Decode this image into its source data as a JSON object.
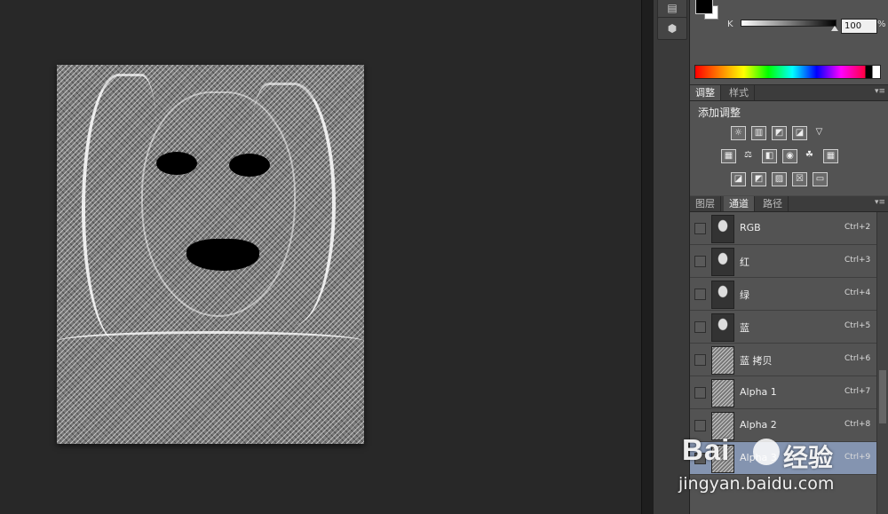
{
  "color_panel": {
    "channel_label": "K",
    "k_value": "100",
    "percent_symbol": "%",
    "foreground_color": "#000000",
    "background_color": "#ffffff"
  },
  "adjustments_panel": {
    "tabs": [
      {
        "label": "调整",
        "active": true
      },
      {
        "label": "样式",
        "active": false
      }
    ],
    "title": "添加调整",
    "rows": [
      [
        "brightness-contrast-icon",
        "levels-icon",
        "curves-icon",
        "exposure-icon",
        "vibrance-icon"
      ],
      [
        "hue-saturation-icon",
        "color-balance-icon",
        "black-white-icon",
        "photo-filter-icon",
        "channel-mixer-icon",
        "color-lookup-icon"
      ],
      [
        "invert-icon",
        "posterize-icon",
        "threshold-icon",
        "selective-color-icon",
        "gradient-map-icon"
      ]
    ]
  },
  "channels_panel": {
    "tabs": [
      {
        "label": "图层",
        "active": false
      },
      {
        "label": "通道",
        "active": true
      },
      {
        "label": "路径",
        "active": false
      }
    ],
    "rows": [
      {
        "name": "RGB",
        "shortcut": "Ctrl+2",
        "thumb": "photo",
        "selected": false
      },
      {
        "name": "红",
        "shortcut": "Ctrl+3",
        "thumb": "photo",
        "selected": false
      },
      {
        "name": "绿",
        "shortcut": "Ctrl+4",
        "thumb": "photo",
        "selected": false
      },
      {
        "name": "蓝",
        "shortcut": "Ctrl+5",
        "thumb": "photo",
        "selected": false
      },
      {
        "name": "蓝 拷贝",
        "shortcut": "Ctrl+6",
        "thumb": "alpha",
        "selected": false
      },
      {
        "name": "Alpha 1",
        "shortcut": "Ctrl+7",
        "thumb": "alpha",
        "selected": false
      },
      {
        "name": "Alpha 2",
        "shortcut": "Ctrl+8",
        "thumb": "alpha",
        "selected": false
      },
      {
        "name": "Alpha 3",
        "shortcut": "Ctrl+9",
        "thumb": "alpha",
        "selected": true
      }
    ]
  },
  "toolbar": {
    "buttons": [
      "panel-toggle-icon",
      "cube-icon"
    ]
  },
  "watermark": {
    "brand": "Bai",
    "brand_cn": "经验",
    "url": "jingyan.baidu.com"
  },
  "colors": {
    "workspace_bg": "#282828",
    "panel_bg": "#535353",
    "selected_row": "#8494b0"
  }
}
